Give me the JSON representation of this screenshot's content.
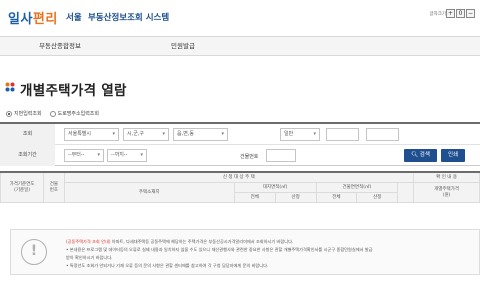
{
  "header": {
    "logo_main": "일사",
    "logo_accent": "편리",
    "city": "서울",
    "system_name": "부동산정보조회 시스템",
    "font_size_label": "글자크기",
    "font_buttons": [
      "+",
      "0",
      "−"
    ]
  },
  "nav": {
    "items": [
      {
        "label": "부동산종합정보"
      },
      {
        "label": "민원발급"
      }
    ]
  },
  "page": {
    "title": "개별주택가격 열람"
  },
  "search_type": {
    "options": [
      {
        "label": "지번입력조회",
        "selected": true
      },
      {
        "label": "도로명주소입력조회",
        "selected": false
      }
    ]
  },
  "search": {
    "row1_label": "조회",
    "sido": "서울특별시",
    "sigungu": "시,군,구",
    "dong": "읍,면,동",
    "san_type": "일반",
    "row2_label": "조회기간",
    "from_year": "--부터--",
    "to_year": "--까지--",
    "building_no_label": "건물번호",
    "search_button": "검색",
    "print_button": "인쇄"
  },
  "table": {
    "group_target": "신 청 대 상 주 택",
    "group_confirm": "확 인 내 용",
    "col_date": "가격기준연도\n(기준일)",
    "col_bldg": "건물\n번호",
    "col_address": "주택소재지",
    "col_land_area": "대지면적(㎡)",
    "col_bldg_area": "건물연면적(㎡)",
    "col_price": "개별주택가격\n(원)",
    "sub_total": "전체",
    "sub_calc": "산정"
  },
  "notice": {
    "lines": [
      {
        "highlight": "(공동주택가격 조회 안내)",
        "text": " 아파트, 다세대주택등 공동주택에 해당하는 주택가격은 부동산공시가격알리미에서 조회하시기 바랍니다."
      },
      {
        "highlight": "",
        "text": "• 본내용은 프로그램 및 데이터등의 오류로 실제 내용과 일치하지 않을 수도 있으니 재산권행사와 관련한 중요한 사항은 관할 개별주택가격확인서를 시군구 종합민원실에서 발급"
      },
      {
        "highlight": "",
        "text": "받아 확인하시기 바랍니다."
      },
      {
        "highlight": "",
        "text": "• 특정년도 조회가 안되거나 기재 오류 등의 문의 사항은 관할 센터에를 참고하여 각 구청 담당자에게 문의 바랍니다."
      }
    ]
  },
  "colors": {
    "brand_blue": "#1c5fa8",
    "brand_orange": "#e8731c",
    "button_blue": "#1f4f8f",
    "notice_red": "#d8342c"
  }
}
